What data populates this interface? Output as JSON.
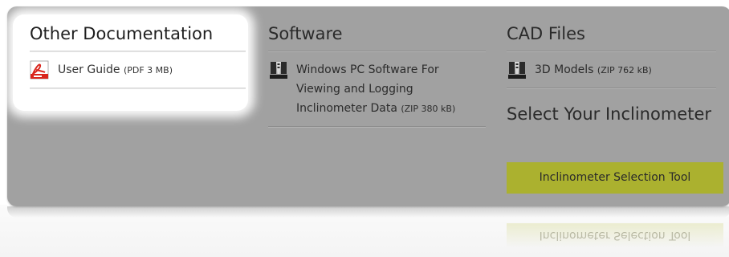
{
  "columns": {
    "documentation": {
      "title": "Other Documentation",
      "links": [
        {
          "label": "User Guide",
          "meta": "(PDF 3 MB)",
          "icon": "pdf-icon"
        }
      ]
    },
    "software": {
      "title": "Software",
      "links": [
        {
          "label": "Windows PC Software For Viewing and Logging Inclinometer Data",
          "meta": "(ZIP 380 kB)",
          "icon": "zip-icon"
        }
      ]
    },
    "cad": {
      "title": "CAD Files",
      "links": [
        {
          "label": "3D Models",
          "meta": "(ZIP 762 kB)",
          "icon": "zip-icon"
        }
      ],
      "select_title": "Select Your Inclinometer",
      "tool_button_label": "Inclinometer Selection Tool"
    }
  },
  "colors": {
    "panel": "#a1a1a1",
    "accent_button": "#abb12f",
    "pdf_red": "#d9251c"
  }
}
